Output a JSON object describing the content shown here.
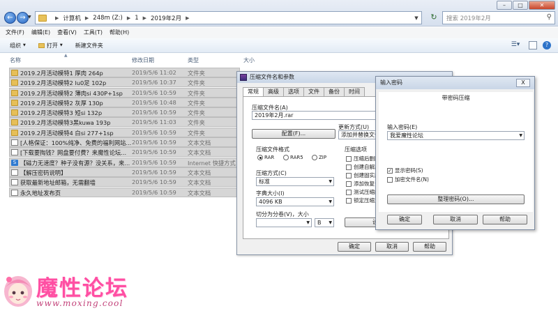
{
  "explorer": {
    "breadcrumb": [
      "计算机",
      "248m (Z:)",
      "1",
      "2019年2月"
    ],
    "search_placeholder": "搜索 2019年2月",
    "menu": [
      "文件(F)",
      "编辑(E)",
      "查看(V)",
      "工具(T)",
      "帮助(H)"
    ],
    "toolbar": {
      "organize": "组织",
      "open": "打开",
      "new_folder": "新建文件夹"
    },
    "columns": {
      "name": "名称",
      "date": "修改日期",
      "type": "类型",
      "size": "大小"
    },
    "files": [
      {
        "name": "2019.2月活动模特1 厚肉 264p",
        "date": "2019/5/6 11:02",
        "type": "文件夹",
        "icon": "folder"
      },
      {
        "name": "2019.2月活动模特2 lu0足 102p",
        "date": "2019/5/6 10:37",
        "type": "文件夹",
        "icon": "folder"
      },
      {
        "name": "2019.2月活动模特2 薄肉si 430P+1sp",
        "date": "2019/5/6 10:59",
        "type": "文件夹",
        "icon": "folder"
      },
      {
        "name": "2019.2月活动模特2 灰厚 130p",
        "date": "2019/5/6 10:48",
        "type": "文件夹",
        "icon": "folder"
      },
      {
        "name": "2019.2月活动模特3 短si 132p",
        "date": "2019/5/6 10:59",
        "type": "文件夹",
        "icon": "folder"
      },
      {
        "name": "2019.2月活动模特3黑kuwa 193p",
        "date": "2019/5/6 11:03",
        "type": "文件夹",
        "icon": "folder"
      },
      {
        "name": "2019.2月活动模特4 白si 277+1sp",
        "date": "2019/5/6 10:59",
        "type": "文件夹",
        "icon": "folder"
      },
      {
        "name": "[人格保证：100%纯净、免费的福利网站...",
        "date": "2019/5/6 10:59",
        "type": "文本文档",
        "icon": "txt"
      },
      {
        "name": "[下载要掏钱？网盘要付费？来魔性论坛...",
        "date": "2019/5/6 10:59",
        "type": "文本文档",
        "icon": "txt"
      },
      {
        "name": "【磁力无速度？种子没有源？没关系，来...",
        "date": "2019/5/6 10:59",
        "type": "Internet 快捷方式",
        "icon": "url"
      },
      {
        "name": "【解压密码说明】",
        "date": "2019/5/6 10:59",
        "type": "文本文档",
        "icon": "txt"
      },
      {
        "name": "获取最新地址邮箱，无需翻墙",
        "date": "2019/5/6 10:59",
        "type": "文本文档",
        "icon": "txt"
      },
      {
        "name": "永久地址发布页",
        "date": "2019/5/6 10:59",
        "type": "文本文档",
        "icon": "txt"
      }
    ]
  },
  "archive_dialog": {
    "title": "压缩文件名和参数",
    "tabs": [
      "常规",
      "高级",
      "选项",
      "文件",
      "备份",
      "时间"
    ],
    "archive_name_label": "压缩文件名(A)",
    "archive_name": "2019年2月.rar",
    "profiles_button": "配置(F)...",
    "update_mode_label": "更新方式(U)",
    "update_mode": "添加并替换文件",
    "format_label": "压缩文件格式",
    "formats": [
      "RAR",
      "RAR5",
      "ZIP"
    ],
    "compression_label": "压缩方式(C)",
    "compression": "标准",
    "dict_label": "字典大小(I)",
    "dict": "4096 KB",
    "split_label": "切分为分卷(V)，大小",
    "split_unit": "B",
    "options_label": "压缩选项",
    "options": [
      "压缩后删除",
      "创建自解压",
      "创建固实压",
      "添加恢复记",
      "测试压缩的",
      "锁定压缩文"
    ],
    "set_password": "设",
    "ok": "确定",
    "cancel": "取消",
    "help": "帮助"
  },
  "password_dialog": {
    "title": "输入密码",
    "close": "X",
    "header": "带密码压缩",
    "password_label": "输入密码(E)",
    "password": "我爱魔性论坛",
    "show_password": "显示密码(S)",
    "encrypt_names": "加密文件名(N)",
    "organize": "整理密码(O)...",
    "ok": "确定",
    "cancel": "取消",
    "help": "帮助"
  },
  "watermark": {
    "title": "魔性论坛",
    "url": "www.moxing.cool"
  }
}
